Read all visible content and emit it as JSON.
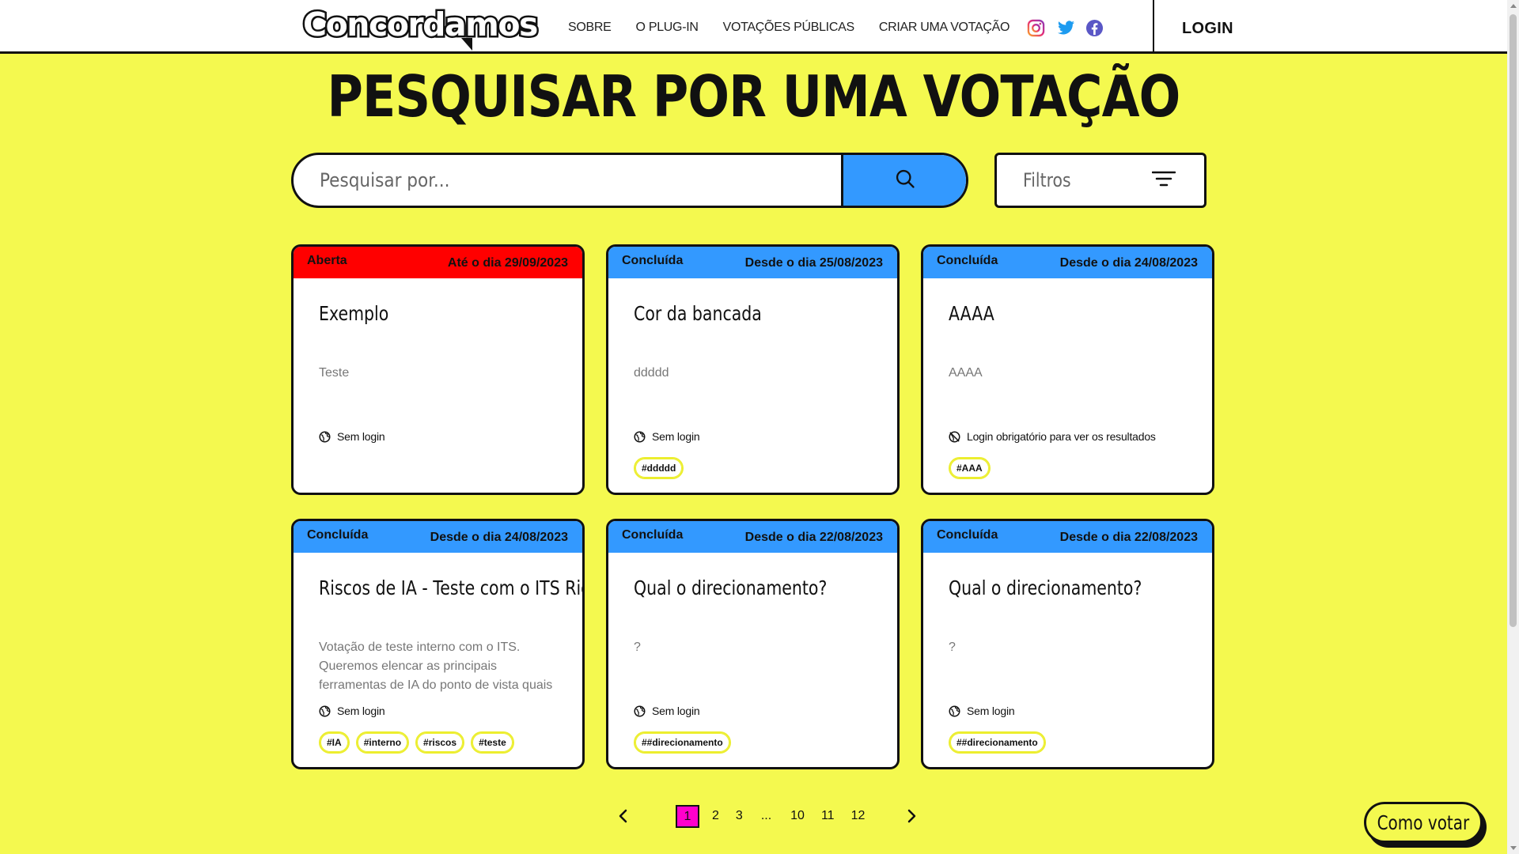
{
  "header": {
    "logo_text": "Concordamos",
    "nav": [
      "SOBRE",
      "O PLUG-IN",
      "VOTAÇÕES PÚBLICAS",
      "CRIAR UMA VOTAÇÃO"
    ],
    "social_icons": [
      "instagram-icon",
      "twitter-icon",
      "facebook-icon"
    ],
    "login_label": "LOGIN"
  },
  "page": {
    "title": "PESQUISAR POR UMA VOTAÇÃO"
  },
  "search": {
    "placeholder": "Pesquisar por...",
    "filters_label": "Filtros"
  },
  "colors": {
    "background": "#f4f94f",
    "open_status": "#ff0000",
    "done_status": "#3399ff",
    "current_page": "#ff00cc",
    "tag_border": "#ecee2e"
  },
  "cards": [
    {
      "status": "Aberta",
      "status_kind": "open",
      "date": "Até o dia 29/09/2023",
      "title": "Exemplo",
      "description": "Teste",
      "access": "Sem login",
      "access_icon": "globe-icon",
      "tags": []
    },
    {
      "status": "Concluída",
      "status_kind": "done",
      "date": "Desde o dia 25/08/2023",
      "title": "Cor da bancada",
      "description": "ddddd",
      "access": "Sem login",
      "access_icon": "globe-icon",
      "tags": [
        "#ddddd"
      ]
    },
    {
      "status": "Concluída",
      "status_kind": "done",
      "date": "Desde o dia 24/08/2023",
      "title": "AAAA",
      "description": "AAAA",
      "access": "Login obrigatório para ver os resultados",
      "access_icon": "globe-off-icon",
      "tags": [
        "#AAA"
      ]
    },
    {
      "status": "Concluída",
      "status_kind": "done",
      "date": "Desde o dia 24/08/2023",
      "title": "Riscos de IA - Teste com o ITS Rio",
      "description": "Votação de teste interno com o ITS. Queremos elencar as principais ferramentas de IA do ponto de vista quais trazem maior",
      "access": "Sem login",
      "access_icon": "globe-icon",
      "tags": [
        "#IA",
        "#interno",
        "#riscos",
        "#teste"
      ]
    },
    {
      "status": "Concluída",
      "status_kind": "done",
      "date": "Desde o dia 22/08/2023",
      "title": "Qual o direcionamento?",
      "description": "?",
      "access": "Sem login",
      "access_icon": "globe-icon",
      "tags": [
        "##direcionamento"
      ]
    },
    {
      "status": "Concluída",
      "status_kind": "done",
      "date": "Desde o dia 22/08/2023",
      "title": "Qual o direcionamento?",
      "description": "?",
      "access": "Sem login",
      "access_icon": "globe-icon",
      "tags": [
        "##direcionamento"
      ]
    }
  ],
  "pagination": {
    "pages": [
      "1",
      "2",
      "3",
      "...",
      "10",
      "11",
      "12"
    ],
    "current": "1"
  },
  "help": {
    "how_to_vote_label": "Como votar"
  }
}
